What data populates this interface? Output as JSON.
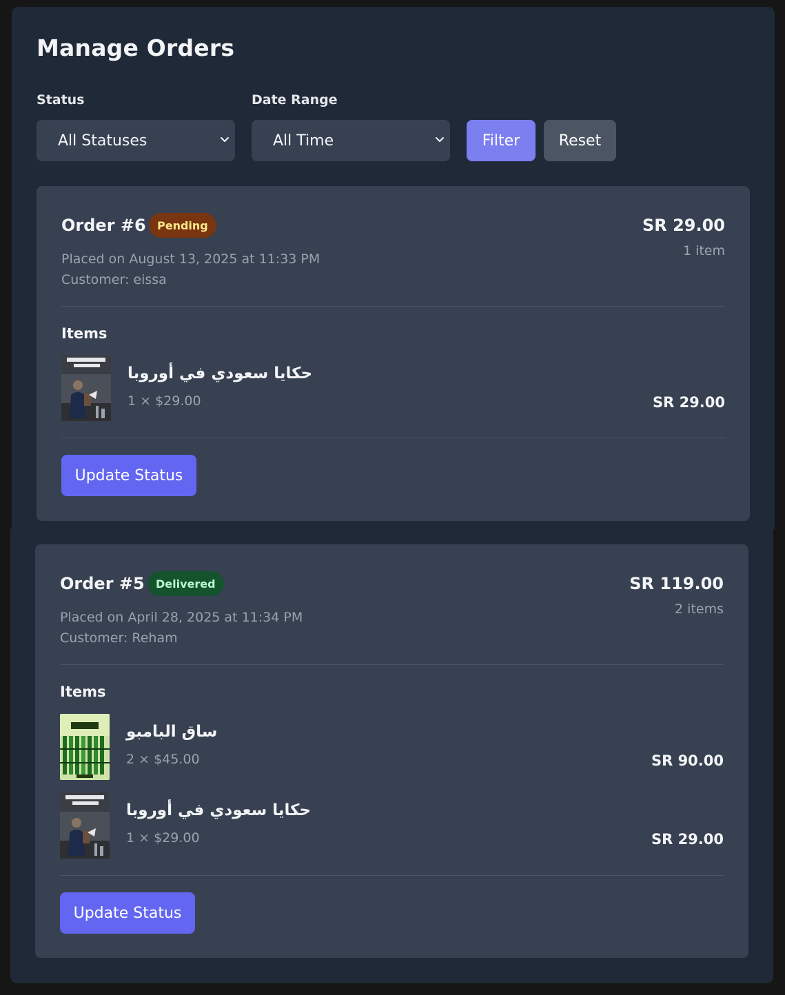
{
  "page": {
    "title": "Manage Orders"
  },
  "filters": {
    "status_label": "Status",
    "status_value": "All Statuses",
    "date_label": "Date Range",
    "date_value": "All Time",
    "filter_button": "Filter",
    "reset_button": "Reset"
  },
  "colors": {
    "primary": "#6366f1",
    "filter_button": "#7c7ff0",
    "pending_badge_bg": "#78350f",
    "pending_badge_text": "#fde68a",
    "delivered_badge_bg": "#14532d",
    "delivered_badge_text": "#bbf7d0"
  },
  "orders": [
    {
      "title": "Order #6",
      "status": "Pending",
      "placed": "Placed on August 13, 2025 at 11:33 PM",
      "customer": "Customer: eissa",
      "total": "SR 29.00",
      "count": "1 item",
      "items_heading": "Items",
      "items": [
        {
          "name": "حكايا سعودي في أوروبا",
          "qty": "1 × $29.00",
          "price": "SR 29.00",
          "cover_icon": "book-cover-traveler-icon"
        }
      ],
      "update_button": "Update Status"
    },
    {
      "title": "Order #5",
      "status": "Delivered",
      "placed": "Placed on April 28, 2025 at 11:34 PM",
      "customer": "Customer: Reham",
      "total": "SR 119.00",
      "count": "2 items",
      "items_heading": "Items",
      "items": [
        {
          "name": "ساق البامبو",
          "qty": "2 × $45.00",
          "price": "SR 90.00",
          "cover_icon": "book-cover-bamboo-icon"
        },
        {
          "name": "حكايا سعودي في أوروبا",
          "qty": "1 × $29.00",
          "price": "SR 29.00",
          "cover_icon": "book-cover-traveler-icon"
        }
      ],
      "update_button": "Update Status"
    }
  ]
}
